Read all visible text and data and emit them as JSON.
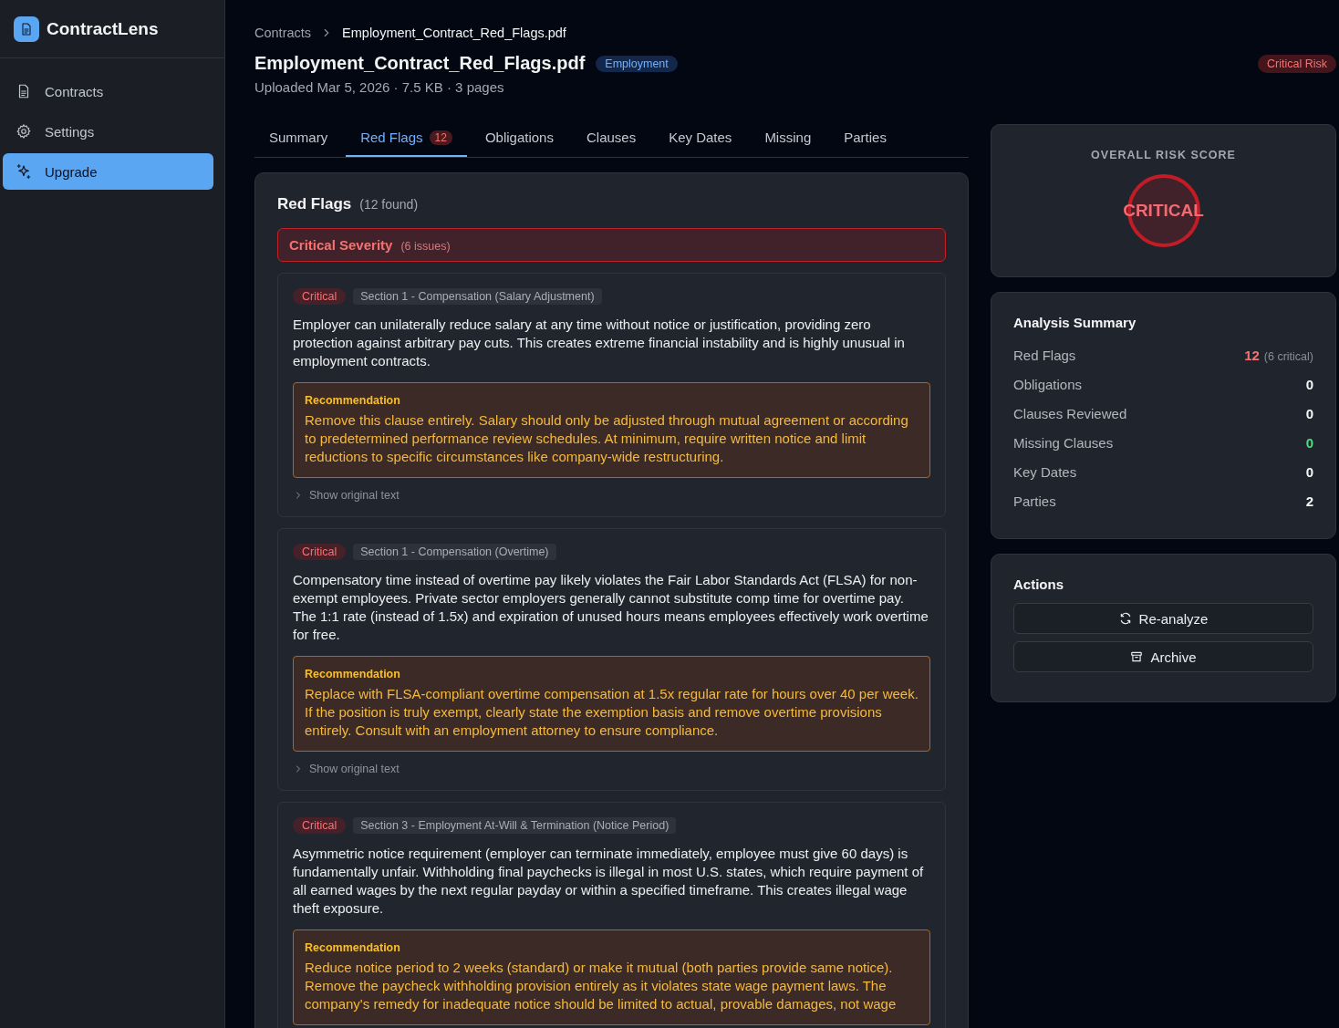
{
  "app": {
    "name": "ContractLens"
  },
  "sidebar": {
    "items": [
      {
        "label": "Contracts",
        "selected": false
      },
      {
        "label": "Settings",
        "selected": false
      },
      {
        "label": "Upgrade",
        "selected": true
      }
    ]
  },
  "breadcrumb": [
    "Contracts",
    "Employment_Contract_Red_Flags.pdf"
  ],
  "document": {
    "title": "Employment_Contract_Red_Flags.pdf",
    "category": "Employment",
    "meta": "Uploaded Mar 5, 2026 · 7.5 KB · 3 pages",
    "risk_badge": "Critical Risk"
  },
  "tabs": [
    {
      "label": "Summary",
      "selected": false
    },
    {
      "label": "Red Flags",
      "count": "12",
      "selected": true
    },
    {
      "label": "Obligations",
      "selected": false
    },
    {
      "label": "Clauses",
      "selected": false
    },
    {
      "label": "Key Dates",
      "selected": false
    },
    {
      "label": "Missing",
      "selected": false
    },
    {
      "label": "Parties",
      "selected": false
    }
  ],
  "red_flags": {
    "title": "Red Flags",
    "count": "(12 found)",
    "group": {
      "kind": "critical",
      "title": "Critical Severity",
      "count": "(6 issues)"
    },
    "items": [
      {
        "kind": "critical",
        "severity_label": "Critical",
        "section": "Section 1 - Compensation (Salary Adjustment)",
        "description": "Employer can unilaterally reduce salary at any time without notice or justification, providing zero protection against arbitrary pay cuts. This creates extreme financial instability and is highly unusual in employment contracts.",
        "recommendation_title": "Recommendation",
        "recommendation": "Remove this clause entirely. Salary should only be adjusted through mutual agreement or according to predetermined performance review schedules. At minimum, require written notice and limit reductions to specific circumstances like company-wide restructuring.",
        "show_original": "Show original text"
      },
      {
        "kind": "critical",
        "severity_label": "Critical",
        "section": "Section 1 - Compensation (Overtime)",
        "description": "Compensatory time instead of overtime pay likely violates the Fair Labor Standards Act (FLSA) for non-exempt employees. Private sector employers generally cannot substitute comp time for overtime pay. The 1:1 rate (instead of 1.5x) and expiration of unused hours means employees effectively work overtime for free.",
        "recommendation_title": "Recommendation",
        "recommendation": "Replace with FLSA-compliant overtime compensation at 1.5x regular rate for hours over 40 per week. If the position is truly exempt, clearly state the exemption basis and remove overtime provisions entirely. Consult with an employment attorney to ensure compliance.",
        "show_original": "Show original text"
      },
      {
        "kind": "critical",
        "severity_label": "Critical",
        "section": "Section 3 - Employment At-Will & Termination (Notice Period)",
        "description": "Asymmetric notice requirement (employer can terminate immediately, employee must give 60 days) is fundamentally unfair. Withholding final paychecks is illegal in most U.S. states, which require payment of all earned wages by the next regular payday or within a specified timeframe. This creates illegal wage theft exposure.",
        "recommendation_title": "Recommendation",
        "recommendation": "Reduce notice period to 2 weeks (standard) or make it mutual (both parties provide same notice). Remove the paycheck withholding provision entirely as it violates state wage payment laws. The company's remedy for inadequate notice should be limited to actual, provable damages, not wage"
      }
    ]
  },
  "risk_score": {
    "title": "OVERALL RISK SCORE",
    "kind": "critical",
    "label": "CRITICAL"
  },
  "analysis_summary": {
    "title": "Analysis Summary",
    "rows": [
      {
        "label": "Red Flags",
        "value": "12",
        "note": "(6 critical)",
        "color": "#f87171"
      },
      {
        "label": "Obligations",
        "value": "0",
        "color": "#f3f4f6"
      },
      {
        "label": "Clauses Reviewed",
        "value": "0",
        "color": "#f3f4f6"
      },
      {
        "label": "Missing Clauses",
        "value": "0",
        "color": "#4ade80"
      },
      {
        "label": "Key Dates",
        "value": "0",
        "color": "#f3f4f6"
      },
      {
        "label": "Parties",
        "value": "2",
        "color": "#f3f4f6"
      }
    ]
  },
  "actions": {
    "title": "Actions",
    "buttons": [
      {
        "label": "Re-analyze"
      },
      {
        "label": "Archive"
      }
    ]
  }
}
